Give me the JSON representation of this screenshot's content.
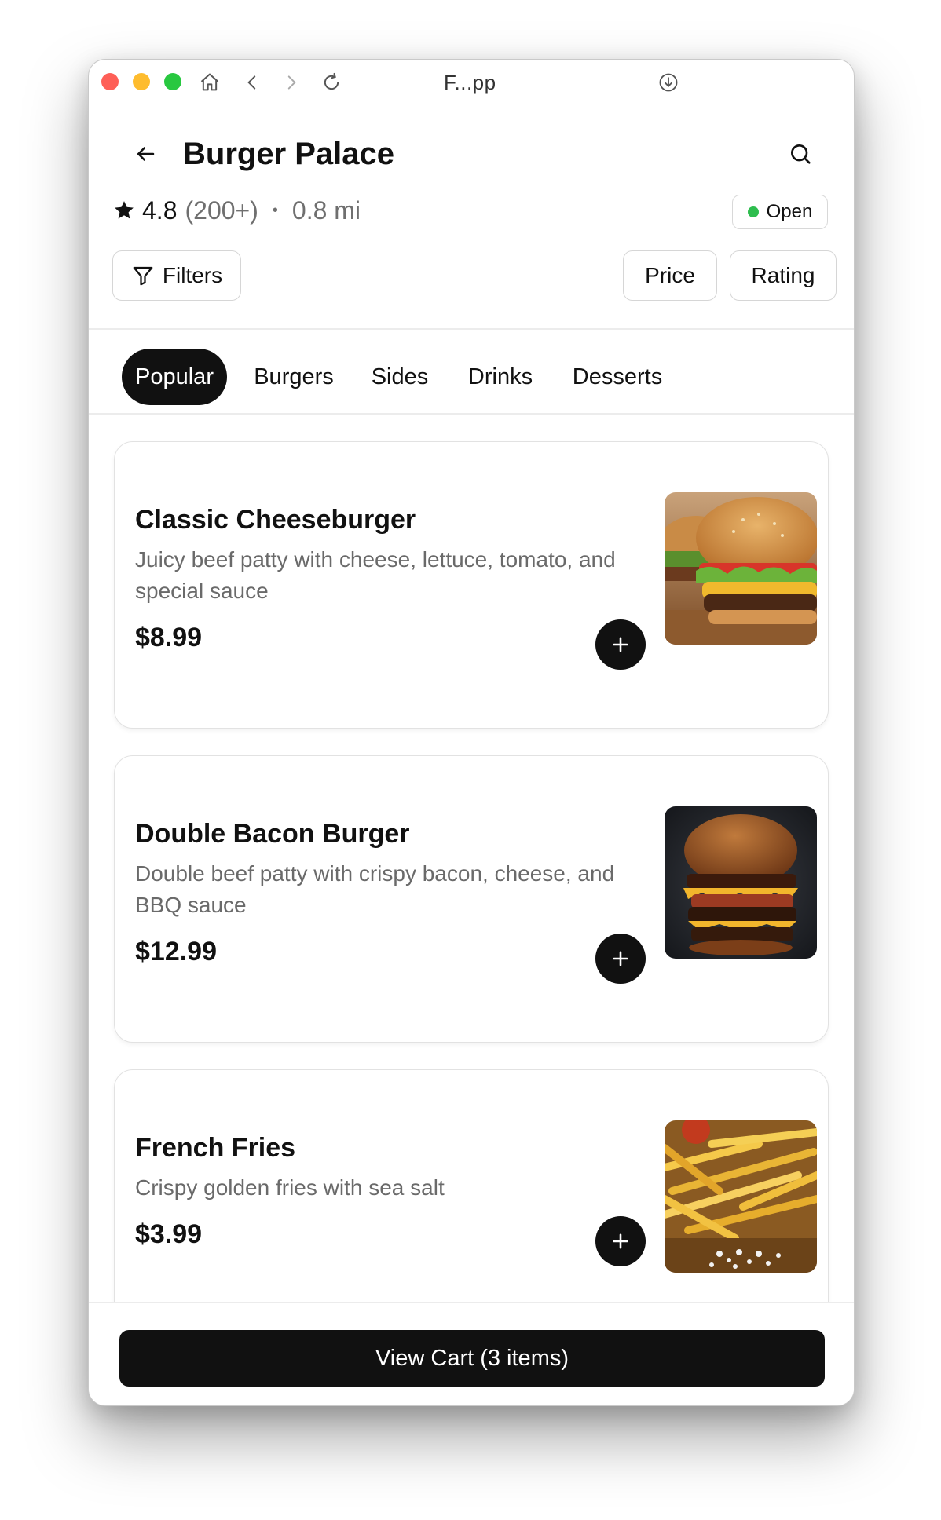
{
  "window": {
    "title": "F...pp"
  },
  "header": {
    "title": "Burger Palace"
  },
  "restaurant": {
    "rating": "4.8",
    "reviews": "(200+)",
    "separator": "•",
    "distance": "0.8 mi",
    "status": "Open",
    "status_color": "#2ebd4e"
  },
  "filters": {
    "filters_label": "Filters",
    "price_label": "Price",
    "rating_label": "Rating"
  },
  "tabs": [
    {
      "label": "Popular",
      "active": true
    },
    {
      "label": "Burgers",
      "active": false
    },
    {
      "label": "Sides",
      "active": false
    },
    {
      "label": "Drinks",
      "active": false
    },
    {
      "label": "Desserts",
      "active": false
    }
  ],
  "menu_items": [
    {
      "name": "Classic Cheeseburger",
      "description": "Juicy beef patty with cheese, lettuce, tomato, and special sauce",
      "price": "$8.99",
      "image": "cheeseburger-photo"
    },
    {
      "name": "Double Bacon Burger",
      "description": "Double beef patty with crispy bacon, cheese, and BBQ sauce",
      "price": "$12.99",
      "image": "bacon-burger-photo"
    },
    {
      "name": "French Fries",
      "description": "Crispy golden fries with sea salt",
      "price": "$3.99",
      "image": "french-fries-photo"
    }
  ],
  "cart": {
    "label": "View Cart (3 items)"
  },
  "colors": {
    "primary": "#111111",
    "muted_text": "#6a6a6a",
    "border": "#e2e2e2"
  }
}
